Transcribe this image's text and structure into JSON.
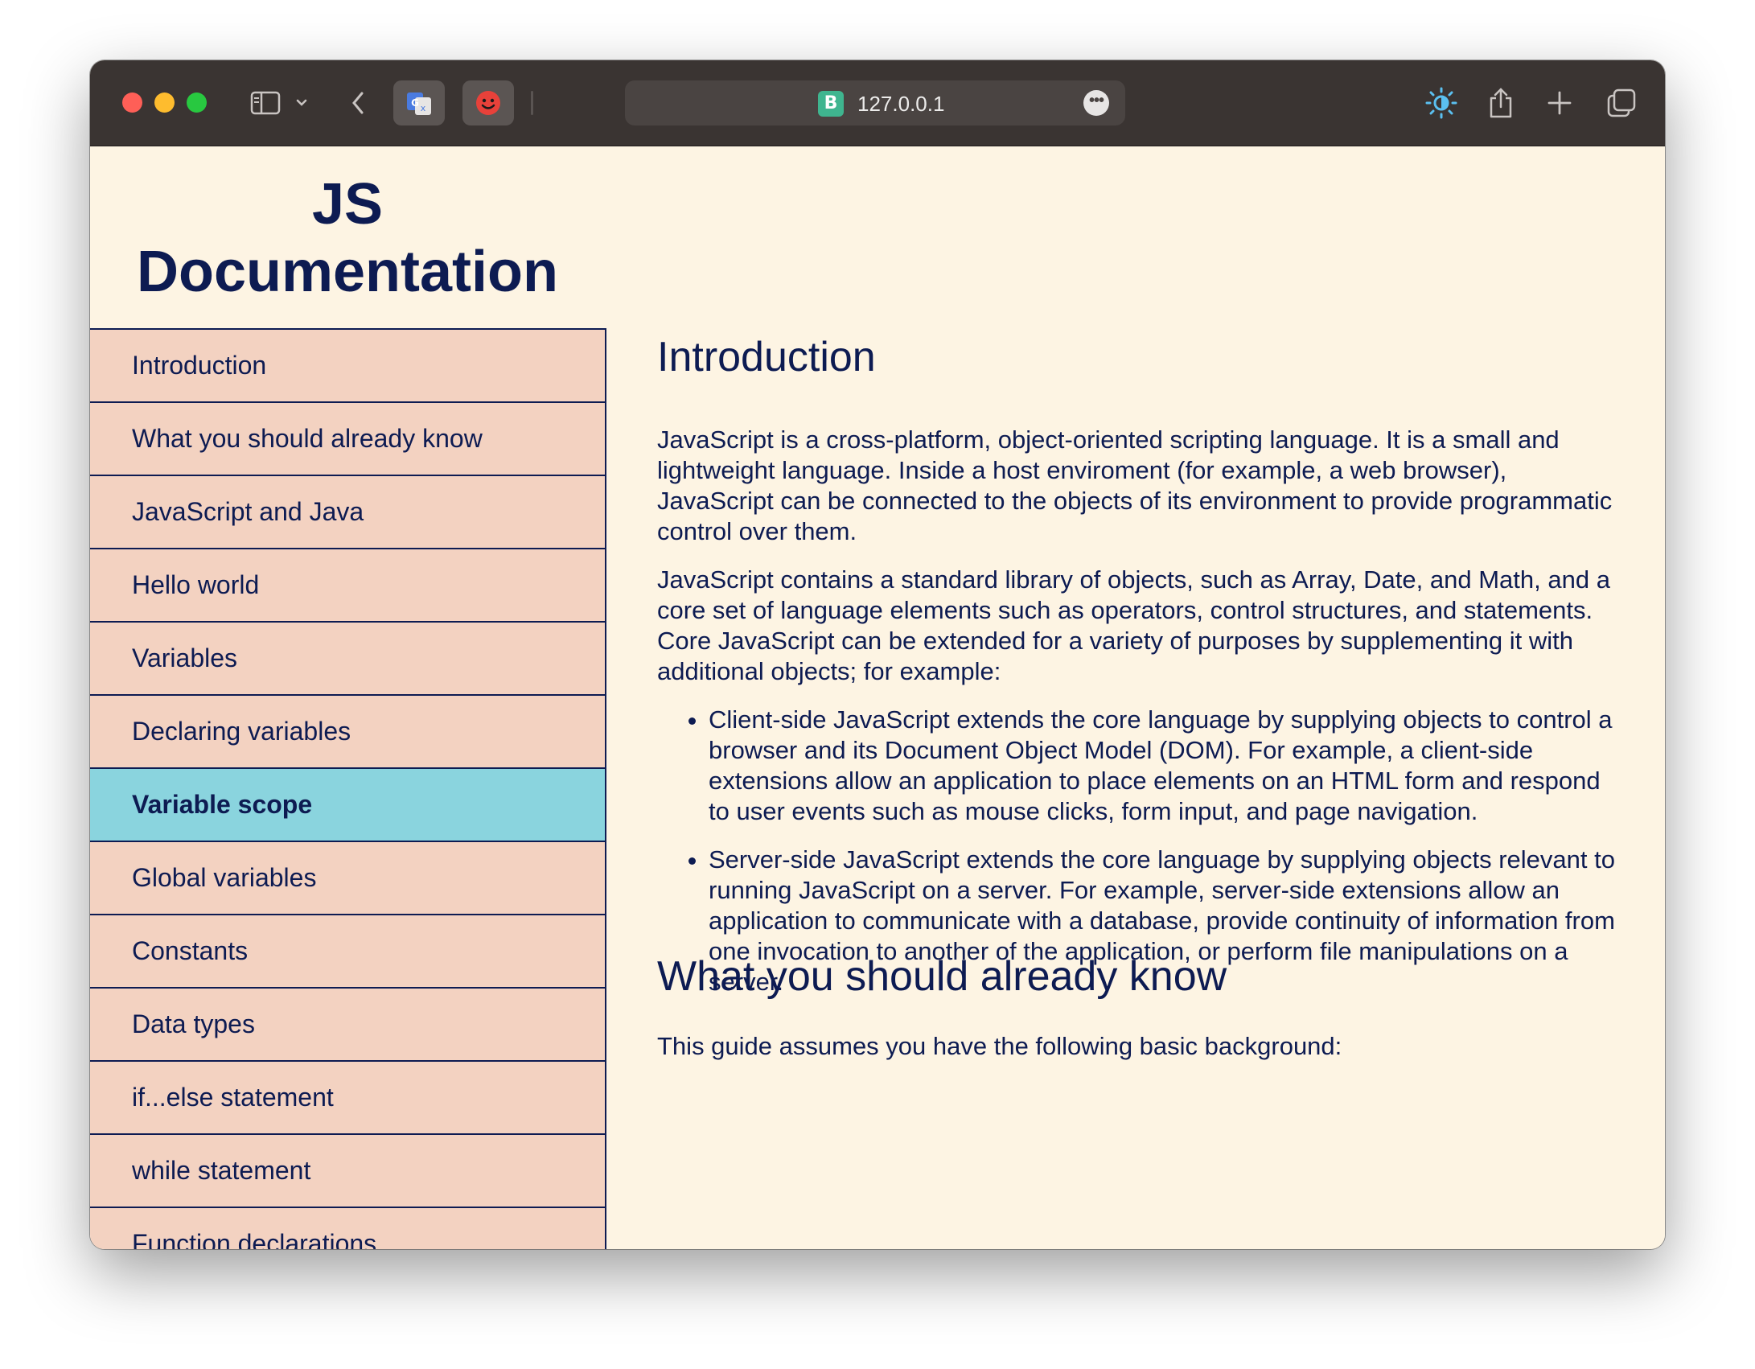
{
  "browser": {
    "url": "127.0.0.1",
    "favicon_letter": "B"
  },
  "page": {
    "title_line1": "JS",
    "title_line2": "Documentation"
  },
  "nav": {
    "items": [
      {
        "label": "Introduction"
      },
      {
        "label": "What you should already know"
      },
      {
        "label": "JavaScript and Java"
      },
      {
        "label": "Hello world"
      },
      {
        "label": "Variables"
      },
      {
        "label": "Declaring variables"
      },
      {
        "label": "Variable scope",
        "active": true
      },
      {
        "label": "Global variables"
      },
      {
        "label": "Constants"
      },
      {
        "label": "Data types"
      },
      {
        "label": "if...else statement"
      },
      {
        "label": "while statement"
      },
      {
        "label": "Function declarations"
      }
    ]
  },
  "main": {
    "sections": [
      {
        "title": "Introduction",
        "paragraphs": [
          "JavaScript is a cross-platform, object-oriented scripting language. It is a small and lightweight language. Inside a host enviroment (for example, a web browser), JavaScript can be connected to the objects of its environment to provide programmatic control over them.",
          "JavaScript contains a standard library of objects, such as Array, Date, and Math, and a core set of language elements such as operators, control structures, and statements. Core JavaScript can be extended for a variety of purposes by supplementing it with additional objects; for example:"
        ],
        "bullets": [
          "Client-side JavaScript extends the core language by supplying objects to control a browser and its Document Object Model (DOM). For example, a client-side extensions allow an application to place elements on an HTML form and respond to user events such as mouse clicks, form input, and page navigation.",
          "Server-side JavaScript extends the core language by supplying objects relevant to running JavaScript on a server. For example, server-side extensions allow an application to communicate with a database, provide continuity of information from one invocation to another of the application, or perform file manipulations on a server."
        ]
      },
      {
        "title": "What you should already know",
        "paragraphs": [
          "This guide assumes you have the following basic background:"
        ]
      }
    ]
  },
  "colors": {
    "text": "#0d1b52",
    "nav_bg": "#f3d2c1",
    "nav_active_bg": "#8ad4de",
    "page_bg": "#fdf4e3",
    "toolbar_bg": "#3a3432"
  }
}
